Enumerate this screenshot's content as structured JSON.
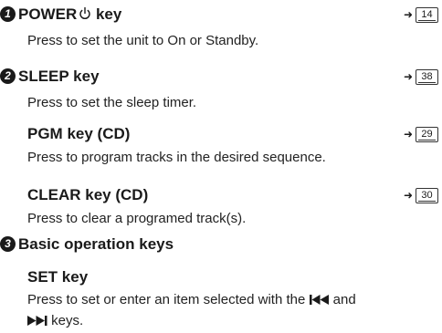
{
  "sections": [
    {
      "number": "1",
      "title": "POWER",
      "suffix": "key",
      "page_ref": "14",
      "description": "Press to set the unit to On or Standby."
    },
    {
      "number": "2",
      "title": "SLEEP key",
      "page_ref": "38",
      "description": "Press to set the sleep timer."
    },
    {
      "title": "PGM key (CD)",
      "page_ref": "29",
      "description": "Press to program tracks in the desired sequence."
    },
    {
      "title": "CLEAR key (CD)",
      "page_ref": "30",
      "description": "Press to clear a programed track(s)."
    },
    {
      "number": "3",
      "title": "Basic operation keys"
    },
    {
      "title": "SET key",
      "description_line1": "Press to set or enter an item selected with the",
      "description_and": "and",
      "description_line2": "keys."
    }
  ],
  "icons": {
    "power": "power-symbol-icon",
    "page_ref": "book-page-icon",
    "arrow": "right-arrow-icon",
    "skip_back": "skip-back-icon",
    "skip_forward": "skip-forward-icon"
  }
}
